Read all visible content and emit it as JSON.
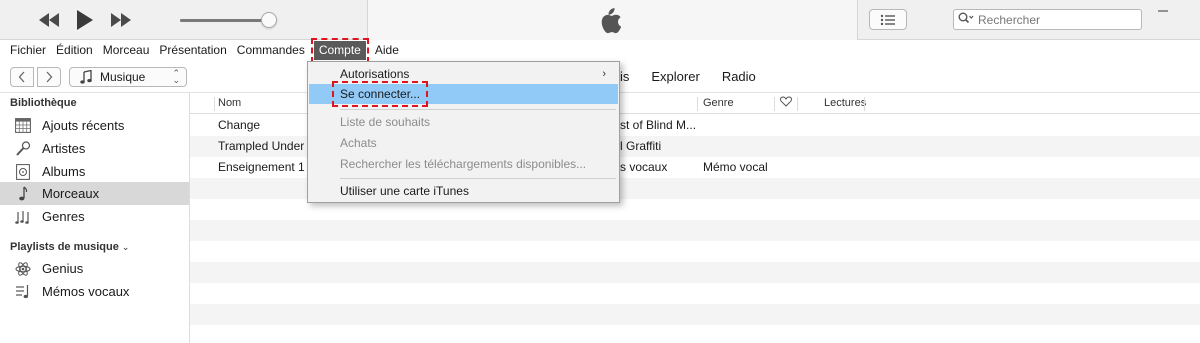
{
  "player": {
    "rewind_icon": "rewind-icon",
    "play_icon": "play-icon",
    "forward_icon": "fast-forward-icon",
    "volume_level": 0.9
  },
  "header": {
    "logo_icon": "apple-logo-icon",
    "list_icon": "list-icon",
    "search_placeholder": "Rechercher",
    "window_controls": "window-minimize-icon"
  },
  "menubar": {
    "items": [
      "Fichier",
      "Édition",
      "Morceau",
      "Présentation",
      "Commandes",
      "Compte",
      "Aide"
    ],
    "active": "Compte",
    "highlight_color": "#e0141e"
  },
  "nav": {
    "media_kind": "Musique",
    "tabs": [
      "is",
      "Explorer",
      "Radio"
    ]
  },
  "sidebar": {
    "library_heading": "Bibliothèque",
    "library_items": [
      {
        "label": "Ajouts récents",
        "icon": "calendar-grid-icon"
      },
      {
        "label": "Artistes",
        "icon": "microphone-icon"
      },
      {
        "label": "Albums",
        "icon": "album-icon"
      },
      {
        "label": "Morceaux",
        "icon": "music-note-icon",
        "selected": true
      },
      {
        "label": "Genres",
        "icon": "genres-icon"
      }
    ],
    "playlists_heading": "Playlists de musique",
    "playlist_items": [
      {
        "label": "Genius",
        "icon": "genius-atom-icon"
      },
      {
        "label": "Mémos vocaux",
        "icon": "playlist-icon"
      }
    ]
  },
  "table": {
    "columns": [
      "Nom",
      "Genre",
      "Lectures"
    ],
    "heart_icon": "heart-icon",
    "rows": [
      {
        "name": "Change",
        "album": "st of Blind M...",
        "genre": ""
      },
      {
        "name": "Trampled Under F",
        "album": "l Graffiti",
        "genre": ""
      },
      {
        "name": "Enseignement 1",
        "album": "s vocaux",
        "genre": "Mémo vocal"
      }
    ]
  },
  "dropdown": {
    "items": [
      {
        "label": "Autorisations",
        "state": "submenu"
      },
      {
        "label": "Se connecter...",
        "state": "highlighted"
      },
      {
        "label": "Liste de souhaits",
        "state": "disabled"
      },
      {
        "label": "Achats",
        "state": "disabled"
      },
      {
        "label": "Rechercher les téléchargements disponibles...",
        "state": "disabled"
      },
      {
        "label": "Utiliser une carte iTunes",
        "state": "normal"
      }
    ],
    "submenu_arrow": "›",
    "highlight_bg": "#91c9f7"
  }
}
